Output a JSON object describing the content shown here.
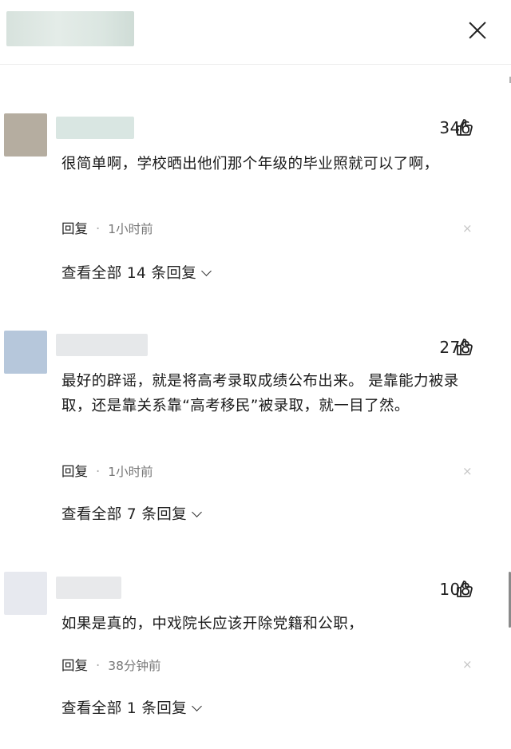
{
  "header": {
    "close_icon": "close-icon"
  },
  "comments": [
    {
      "likes": "346",
      "text": "很简单啊，学校晒出他们那个年级的毕业照就可以了啊，",
      "reply_label": "回复",
      "separator": "·",
      "time": "1小时前",
      "dismiss": "×",
      "view_replies": "查看全部 14 条回复",
      "avatar_color": "#b5ada0",
      "name_color": "#d9e6e2"
    },
    {
      "likes": "278",
      "text": "最好的辟谣，就是将高考录取成绩公布出来。 是靠能力被录取，还是靠关系靠“高考移民”被录取，就一目了然。",
      "reply_label": "回复",
      "separator": "·",
      "time": "1小时前",
      "dismiss": "×",
      "view_replies": "查看全部 7 条回复",
      "avatar_color": "#b6c7db",
      "name_color": "#e6e8ea"
    },
    {
      "likes": "108",
      "text": "如果是真的，中戏院长应该开除党籍和公职，",
      "reply_label": "回复",
      "separator": "·",
      "time": "38分钟前",
      "dismiss": "×",
      "view_replies": "查看全部 1 条回复",
      "avatar_color": "#e7e9ef",
      "name_color": "#e8e9eb"
    }
  ]
}
